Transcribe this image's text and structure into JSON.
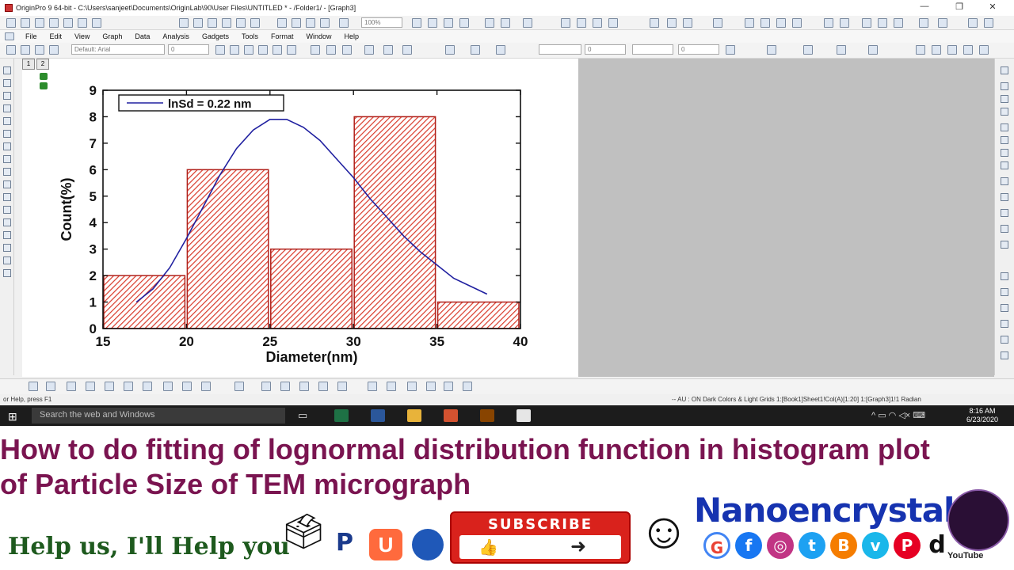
{
  "window": {
    "title": "OriginPro 9 64-bit - C:\\Users\\sanjeet\\Documents\\OriginLab\\90\\User Files\\UNTITLED * - /Folder1/ - [Graph3]",
    "minimize": "—",
    "restore": "❐",
    "close": "✕"
  },
  "menu": {
    "items": [
      "File",
      "Edit",
      "View",
      "Graph",
      "Data",
      "Analysis",
      "Gadgets",
      "Tools",
      "Format",
      "Window",
      "Help"
    ]
  },
  "toolbar": {
    "zoom": "100%",
    "font": "Default: Arial",
    "font_size": "0",
    "line_width": "0",
    "fill_value": "0"
  },
  "layers": {
    "tab1": "1",
    "tab2": "2"
  },
  "status": {
    "help": "or Help, press F1",
    "info": "-- AU : ON  Dark Colors & Light Grids  1:[Book1]Sheet1!Col(A)[1:20]  1:[Graph3]1!1  Radian"
  },
  "taskbar": {
    "search_placeholder": "Search the web and Windows",
    "time": "8:16 AM",
    "date": "6/23/2020"
  },
  "video": {
    "headline_line1": "How to do fitting of lognormal distribution function in histogram plot",
    "headline_line2": "of Particle Size of TEM micrograph",
    "help_text": "Help us, I'll Help you",
    "subscribe_label": "SUBSCRIBE",
    "brand": "Nanoencrystal",
    "youtube_label": "YouTube",
    "social_icons": [
      "google-icon",
      "facebook-icon",
      "instagram-icon",
      "twitter-icon",
      "blogger-icon",
      "vimeo-icon",
      "pinterest-icon",
      "dailymotion-icon"
    ],
    "colors": {
      "headline": "#7a1450",
      "brand": "#1633b0",
      "subscribe": "#d9221c",
      "bar_fill": "#d93a2a",
      "fit_line": "#2020a0"
    }
  },
  "chart_data": {
    "type": "bar",
    "bar_edges": [
      15,
      20,
      25,
      30,
      35,
      40
    ],
    "values": [
      2,
      6,
      3,
      8,
      1
    ],
    "xlabel": "Diameter(nm)",
    "ylabel": "Count(%)",
    "xlim": [
      15,
      40
    ],
    "ylim": [
      0,
      9
    ],
    "xticks": [
      "15",
      "20",
      "25",
      "30",
      "35",
      "40"
    ],
    "yticks": [
      "0",
      "1",
      "2",
      "3",
      "4",
      "5",
      "6",
      "7",
      "8",
      "9"
    ],
    "fit": {
      "name": "lnSd = 0.22 nm",
      "x": [
        17,
        18,
        19,
        20,
        21,
        22,
        23,
        24,
        25,
        26,
        27,
        28,
        29,
        30,
        31,
        32,
        33,
        34,
        35,
        36,
        37,
        38
      ],
      "y": [
        1.0,
        1.5,
        2.3,
        3.4,
        4.6,
        5.8,
        6.8,
        7.5,
        7.9,
        7.9,
        7.6,
        7.1,
        6.4,
        5.7,
        4.9,
        4.2,
        3.5,
        2.9,
        2.4,
        1.9,
        1.6,
        1.3
      ]
    },
    "legend": "top-left",
    "grid": false
  }
}
